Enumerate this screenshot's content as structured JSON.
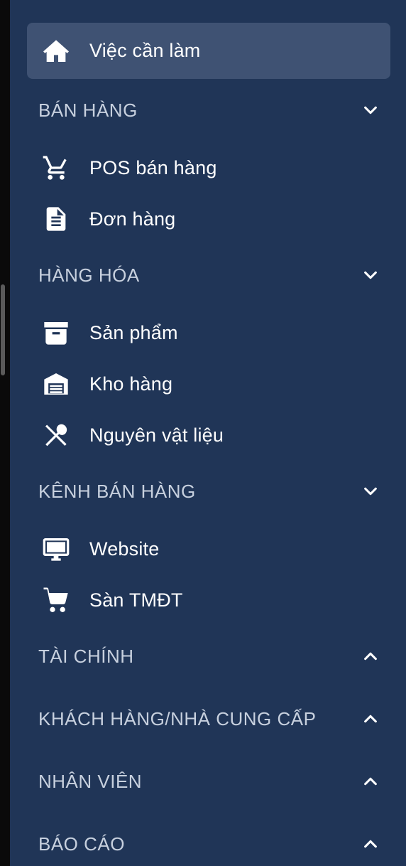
{
  "colors": {
    "sidebar_bg": "#203557",
    "active_bg": "#3f5273",
    "section_text": "#c7d0de",
    "item_text": "#ffffff"
  },
  "active_item": {
    "label": "Việc cần làm",
    "icon": "home-icon"
  },
  "sections": [
    {
      "title": "BÁN HÀNG",
      "expanded": true,
      "items": [
        {
          "label": "POS bán hàng",
          "icon": "shopping-cart-icon"
        },
        {
          "label": "Đơn hàng",
          "icon": "document-icon"
        }
      ]
    },
    {
      "title": "HÀNG HÓA",
      "expanded": true,
      "items": [
        {
          "label": "Sản phẩm",
          "icon": "archive-box-icon"
        },
        {
          "label": "Kho hàng",
          "icon": "warehouse-icon"
        },
        {
          "label": "Nguyên vật liệu",
          "icon": "utensils-icon"
        }
      ]
    },
    {
      "title": "KÊNH BÁN HÀNG",
      "expanded": true,
      "items": [
        {
          "label": "Website",
          "icon": "monitor-icon"
        },
        {
          "label": "Sàn TMĐT",
          "icon": "cart-icon"
        }
      ]
    },
    {
      "title": "TÀI CHÍNH",
      "expanded": false,
      "items": []
    },
    {
      "title": "KHÁCH HÀNG/NHÀ CUNG CẤP",
      "expanded": false,
      "items": []
    },
    {
      "title": "NHÂN VIÊN",
      "expanded": false,
      "items": []
    },
    {
      "title": "BÁO CÁO",
      "expanded": false,
      "items": []
    }
  ]
}
